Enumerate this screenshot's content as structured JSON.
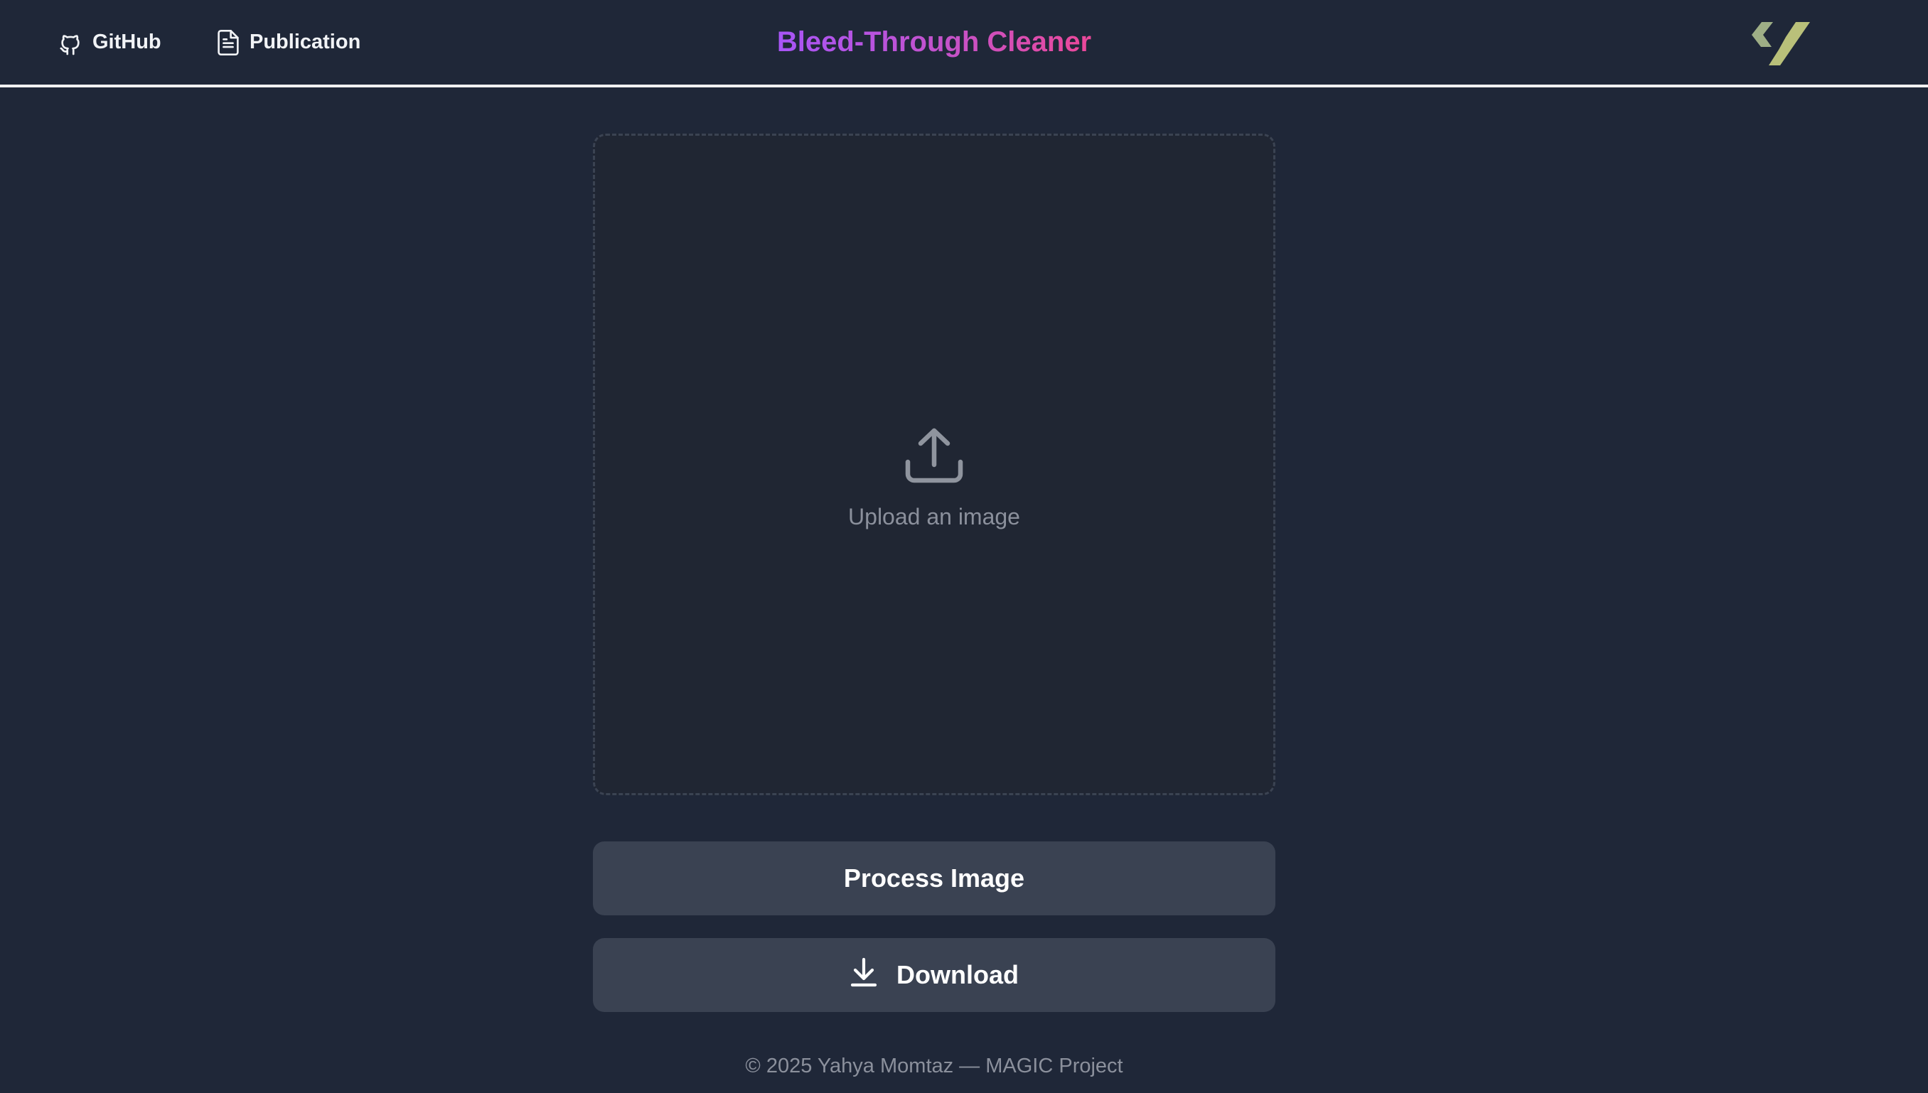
{
  "header": {
    "github_label": "GitHub",
    "publication_label": "Publication",
    "title": "Bleed-Through Cleaner",
    "icons": {
      "github": "github-icon",
      "publication": "document-icon",
      "logo": "brand-logo"
    }
  },
  "dropzone": {
    "icon": "upload-icon",
    "label": "Upload an image"
  },
  "actions": {
    "process_label": "Process Image",
    "download_label": "Download",
    "download_icon": "download-icon"
  },
  "footer": {
    "text": "© 2025 Yahya Momtaz — MAGIC Project"
  },
  "colors": {
    "background": "#1f2738",
    "title_gradient_start": "#a855f7",
    "title_gradient_end": "#ec4899",
    "button_bg": "#3a4252",
    "muted_text": "#8b909c",
    "logo_green_light": "#9eae86",
    "logo_green_dark": "#b9c07a"
  }
}
